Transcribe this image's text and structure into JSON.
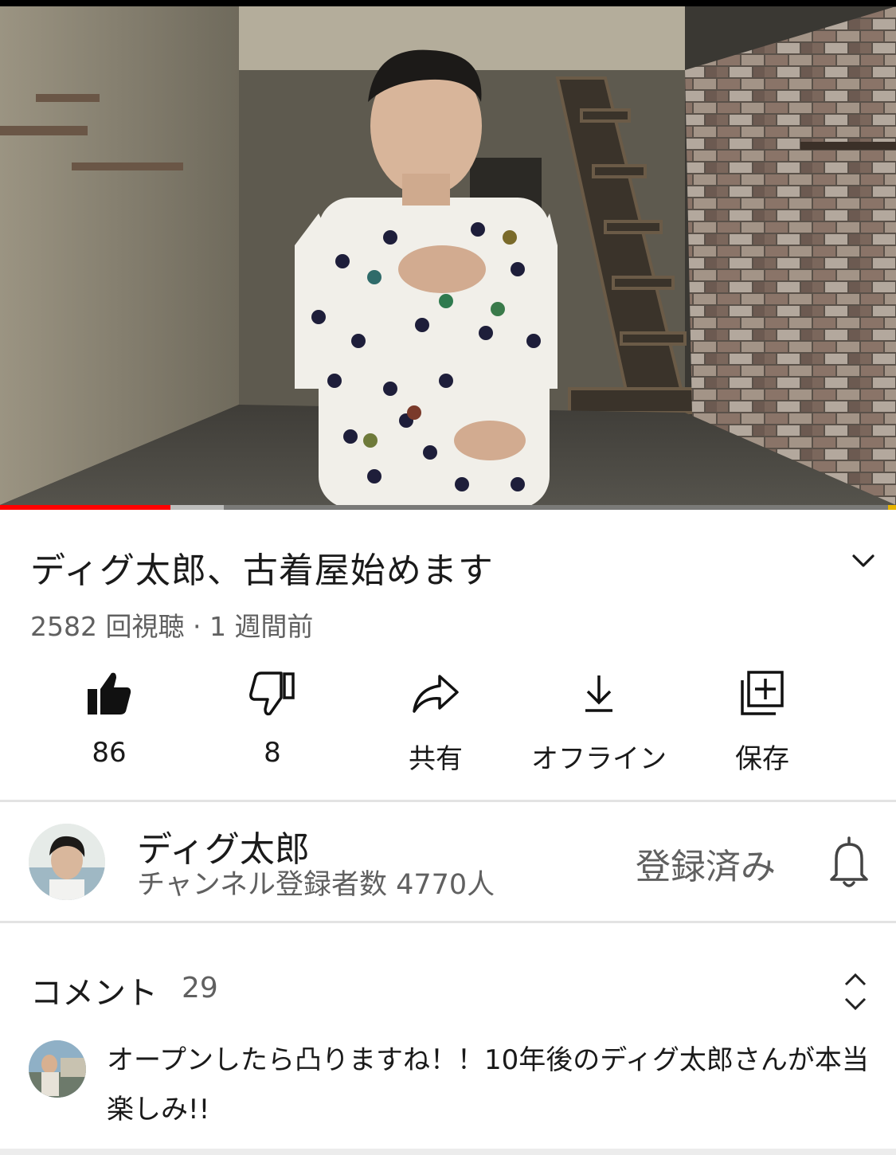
{
  "video": {
    "title": "ディグ太郎、古着屋始めます",
    "meta": "2582 回視聴 · 1 週間前",
    "progress_played_fraction": 0.19,
    "progress_buffered_fraction": 0.25
  },
  "actions": [
    {
      "icon": "thumbs-up-filled-icon",
      "label": "86"
    },
    {
      "icon": "thumbs-down-icon",
      "label": "8"
    },
    {
      "icon": "share-icon",
      "label": "共有"
    },
    {
      "icon": "download-icon",
      "label": "オフライン"
    },
    {
      "icon": "add-to-playlist-icon",
      "label": "保存"
    }
  ],
  "channel": {
    "name": "ディグ太郎",
    "subscribers": "チャンネル登録者数 4770人",
    "subscribed_label": "登録済み"
  },
  "comments": {
    "title": "コメント",
    "count": "29",
    "top_comment": "オープンしたら凸りますね！！10年後のディグ太郎さんが本当楽しみ!!"
  },
  "colors": {
    "accent_red": "#ff0000",
    "secondary_text": "#606060"
  }
}
